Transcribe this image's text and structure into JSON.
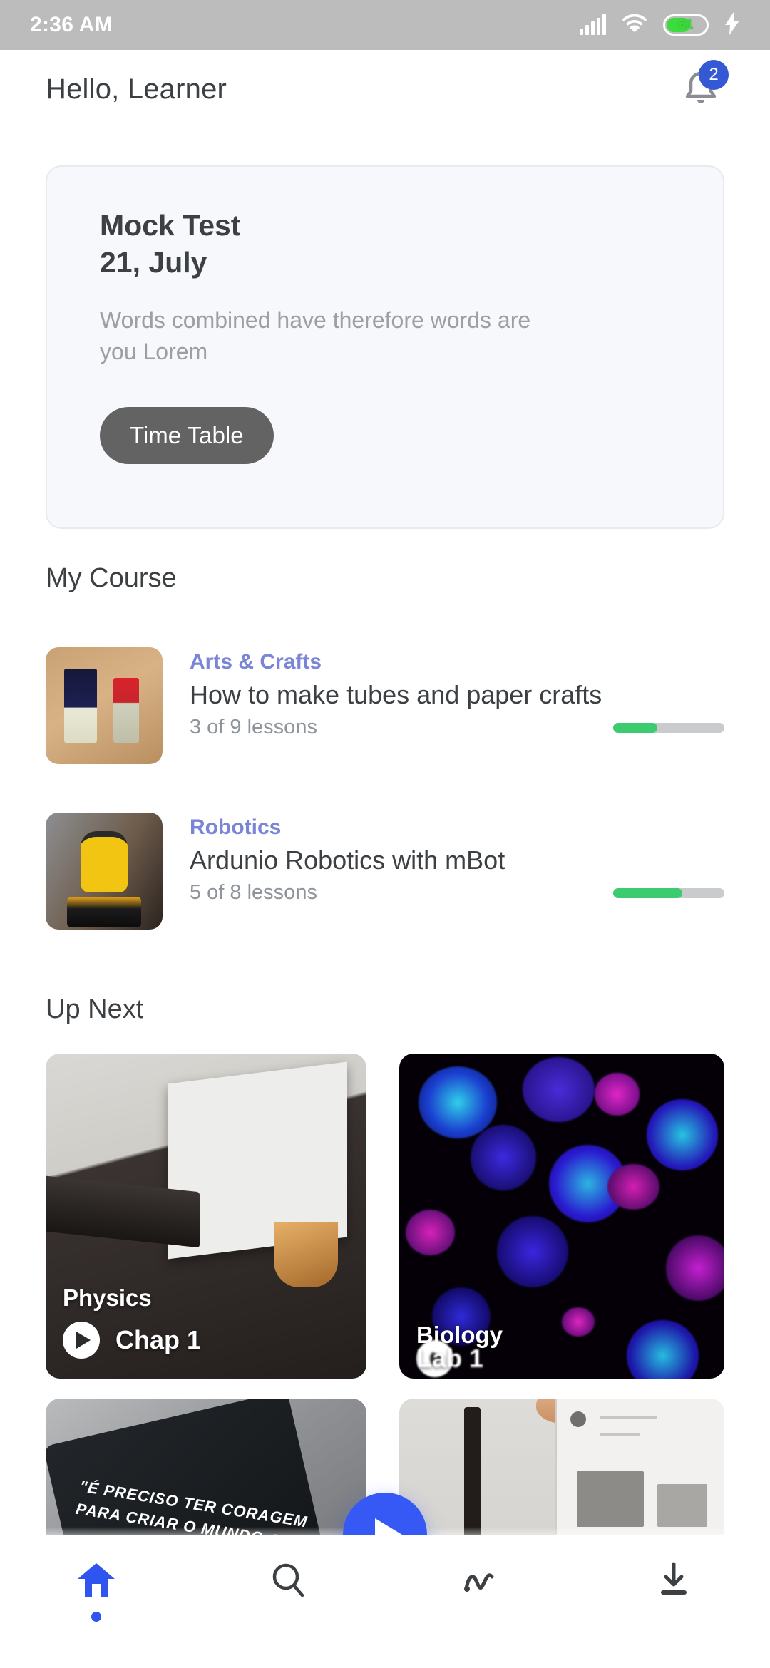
{
  "status_bar": {
    "time": "2:36 AM",
    "battery_percent": "61",
    "icons": [
      "signal-icon",
      "wifi-icon",
      "battery-icon",
      "charging-bolt-icon"
    ]
  },
  "header": {
    "greeting": "Hello, Learner",
    "notification_icon": "bell-icon",
    "notification_count": "2",
    "badge_color": "#3558d4"
  },
  "mock_test": {
    "title": "Mock Test",
    "date": "21, July",
    "description": "Words combined have therefore words are you Lorem",
    "button_label": "Time Table",
    "button_color": "#636363",
    "card_background": "#f7f8fb"
  },
  "my_course": {
    "heading": "My Course",
    "items": [
      {
        "category": "Arts & Crafts",
        "title": "How to make tubes and paper crafts",
        "lessons": "3 of 9 lessons",
        "completed": 3,
        "total": 9,
        "progress_percent": 40,
        "thumbnail": "paintbrushes-photo"
      },
      {
        "category": "Robotics",
        "title": "Ardunio Robotics with mBot",
        "lessons": "5 of 8 lessons",
        "completed": 5,
        "total": 8,
        "progress_percent": 62,
        "thumbnail": "minion-robot-photo"
      }
    ],
    "category_color": "#7b85d8",
    "progress_color": "#3ccb6e"
  },
  "up_next": {
    "heading": "Up Next",
    "cards": [
      {
        "subject": "Physics",
        "chapter": "Chap 1",
        "thumbnail": "desk-keyboard-monitor-photo",
        "play_icon": "play-icon"
      },
      {
        "subject": "Biology",
        "chapter": "Lab 1",
        "thumbnail": "fluorescent-cells-photo",
        "play_icon": "play-icon"
      },
      {
        "subject": "",
        "chapter": "",
        "thumbnail": "black-quote-book-photo",
        "quote_text": "\"É PRECISO TER CORAGEM PARA CRIAR O MUNDO QUE QUER",
        "play_icon": "play-icon"
      },
      {
        "subject": "",
        "chapter": "",
        "thumbnail": "desk-lamp-board-photo",
        "play_icon": "play-icon"
      }
    ]
  },
  "bottom_nav": {
    "items": [
      {
        "name": "home",
        "icon": "home-icon",
        "active": true
      },
      {
        "name": "search",
        "icon": "search-icon",
        "active": false
      },
      {
        "name": "activity",
        "icon": "activity-icon",
        "active": false
      },
      {
        "name": "downloads",
        "icon": "download-icon",
        "active": false
      }
    ],
    "fab": {
      "icon": "play-icon",
      "color": "#3659f5"
    },
    "active_color": "#2f55f0",
    "inactive_color": "#3c4043"
  }
}
